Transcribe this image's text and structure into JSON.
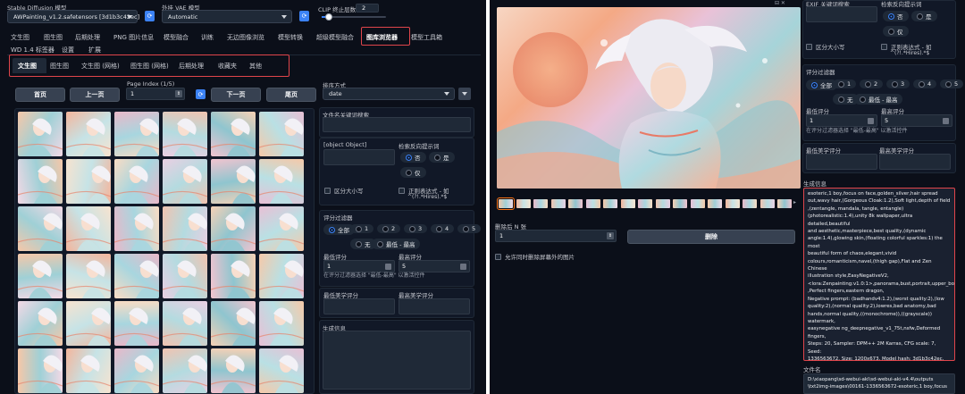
{
  "left": {
    "model": {
      "label": "Stable Diffusion 模型",
      "value": "AWPainting_v1.2.safetensors [3d1b3c42ec]"
    },
    "vae": {
      "label": "外挂 VAE 模型",
      "value": "Automatic"
    },
    "clip": {
      "label": "CLIP 终止层数",
      "value": "2"
    },
    "main_tabs": [
      {
        "label": "文生图"
      },
      {
        "label": "图生图"
      },
      {
        "label": "后期处理"
      },
      {
        "label": "PNG 图片信息"
      },
      {
        "label": "模型融合"
      },
      {
        "label": "训练"
      },
      {
        "label": "无边图像浏览"
      },
      {
        "label": "模型转换"
      },
      {
        "label": "超级模型融合"
      },
      {
        "label": "图库浏览器"
      },
      {
        "label": "模型工具箱"
      }
    ],
    "main_tabs_row2": [
      {
        "label": "WD 1.4 标签器"
      },
      {
        "label": "设置"
      },
      {
        "label": "扩展"
      }
    ],
    "sub_tabs": [
      {
        "label": "文生图"
      },
      {
        "label": "图生图"
      },
      {
        "label": "文生图 (网格)"
      },
      {
        "label": "图生图 (网格)"
      },
      {
        "label": "后期处理"
      },
      {
        "label": "收藏夹"
      },
      {
        "label": "其他"
      }
    ],
    "nav": {
      "first": "首页",
      "prev": "上一页",
      "next": "下一页",
      "last": "尾页"
    },
    "page_index": {
      "label": "Page Index (1/5)",
      "value": "1"
    },
    "sort": {
      "label": "排序方式",
      "value": "date"
    },
    "filename_search": {
      "label": "文件名关键词搜索"
    },
    "exif_search": {
      "label": "EXIF 关键词搜索"
    },
    "neg_search": {
      "label": "检索反向提示词",
      "opt_no": "否",
      "opt_yes": "是",
      "opt_only": "仅"
    },
    "case_sensitive": "区分大小写",
    "regex": {
      "label": "正则表达式 - 如",
      "example": "^(?!.*Hires).*$"
    },
    "rating_filter": {
      "label": "评分过滤器",
      "options": [
        "全部",
        "1",
        "2",
        "3",
        "4",
        "5",
        "无",
        "最低 - 最高"
      ]
    },
    "min_rating": {
      "label": "最低评分",
      "value": "1"
    },
    "max_rating": {
      "label": "最高评分",
      "value": "5"
    },
    "rating_hint": "在评分过滤器选择 \"最低-最高\" 以激活控件",
    "min_aesthetic": "最低美学评分",
    "max_aesthetic": "最高美学评分",
    "gen_info": "生成信息"
  },
  "right": {
    "exif_search": "EXIF 关键词搜索",
    "neg_search": {
      "label": "检索反向提示词",
      "opt_no": "否",
      "opt_yes": "是",
      "opt_only": "仅"
    },
    "case_sensitive": "区分大小写",
    "regex": {
      "label": "正则表达式 - 如",
      "example": "^(?!.*Hires).*$"
    },
    "rating_filter": {
      "label": "评分过滤器",
      "options": [
        "全部",
        "1",
        "2",
        "3",
        "4",
        "5",
        "无",
        "最低 - 最高"
      ]
    },
    "min_rating": {
      "label": "最低评分",
      "value": "1"
    },
    "max_rating": {
      "label": "最高评分",
      "value": "5"
    },
    "rating_hint": "在评分过滤器选择 \"最低-最高\" 以激活控件",
    "min_aesthetic": "最低美学评分",
    "max_aesthetic": "最高美学评分",
    "delete_next": {
      "label": "删除后 N 张",
      "value": "1"
    },
    "delete_button": "删除",
    "allow_delete_outside": "允许同时删除屏幕外的图片",
    "gen_info_label": "生成信息",
    "gen_info_lines": [
      "esoteric,1 boy,focus on face,golden_silver,hair spread",
      "out,wavy hair,(Gorgeous Cloak:1.2),Soft light,depth of field",
      ",(zentangle, mandala, tangle, entangle)",
      "(photorealistic:1.4),unity 8k wallpaper,ultra detailed,beautiful",
      "and aesthetic,masterpiece,best quality,(dynamic",
      "angle:1.4),glowing skin,(floating colorful sparkles:1) the most",
      "beautiful form of chaos,elegant,vivid",
      "colours,romanticism,navel,(thigh gap),Flat and Zen Chinese",
      "illustration style,EasyNegativeV2,",
      "<lora:Zenpainting:v1.0:1>,panorama,bust,portrait,upper_body",
      ",Perfect fingers,eastern dragon,",
      "Negative prompt: (badhandv4:1.2),(worst quality:2),(low",
      "quality:2),(normal quality:2),lowres,bad anatomy,bad",
      "hands,normal quality,((monochrome)),((grayscale))",
      "watermark,",
      "easynegative ng_deepnegative_v1_75t,nsfw,Deformed",
      "fingers,",
      "Steps: 20, Sampler: DPM++ 2M Karras, CFG scale: 7, Seed:",
      "1336563672, Size: 1200x673, Model hash: 3d1b3c42ec, Model:",
      "AWPainting_v1.2, Clip skip: 2, ControlNet 0: \"Module:",
      "openpose_full, Model: control_v11p_sd15_openpose_fp16",
      "[73c2b67d], Weight: 1, Resize Mode: Crop and Resize, Low"
    ],
    "filename": {
      "label": "文件名",
      "lines": [
        "D:\\xiaopang\\sd-webui-aki\\sd-webui-aki-v4.4\\outputs",
        "\\txt2img-images\\00161-1336563672-esoteric,1 boy,focus on"
      ]
    }
  },
  "colors": {
    "background": "#0b0f19",
    "panel": "#111827",
    "input": "#1f2937",
    "accent": "#3b82f6",
    "highlight": "#e0454b"
  }
}
